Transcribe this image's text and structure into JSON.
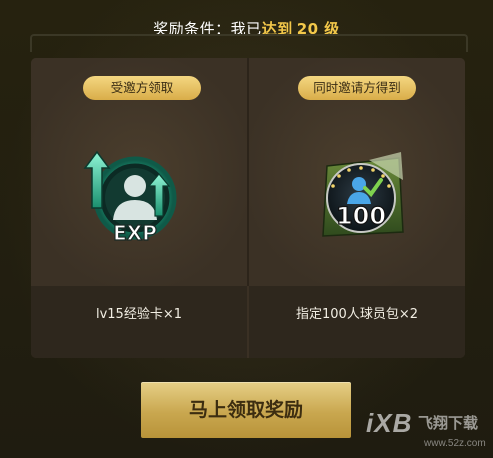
{
  "header": {
    "prefix": "奖励条件：我已",
    "highlight": "达到",
    "level": "20 级"
  },
  "rewards": [
    {
      "badge": "受邀方领取",
      "name": "lv15经验卡×1",
      "icon_label": "EXP",
      "icon": "exp-card-icon"
    },
    {
      "badge": "同时邀请方得到",
      "name": "指定100人球员包×2",
      "icon_label": "100",
      "icon": "player-pack-icon"
    }
  ],
  "claim_button": {
    "label": "马上领取奖励"
  },
  "watermark": {
    "main": "iXB",
    "cn": "飞翔下载",
    "sub": "www.52z.com"
  },
  "colors": {
    "accent": "#f3c84a",
    "panel": "#3a3024",
    "button": "#d1b062",
    "teal": "#2fd3a9"
  }
}
